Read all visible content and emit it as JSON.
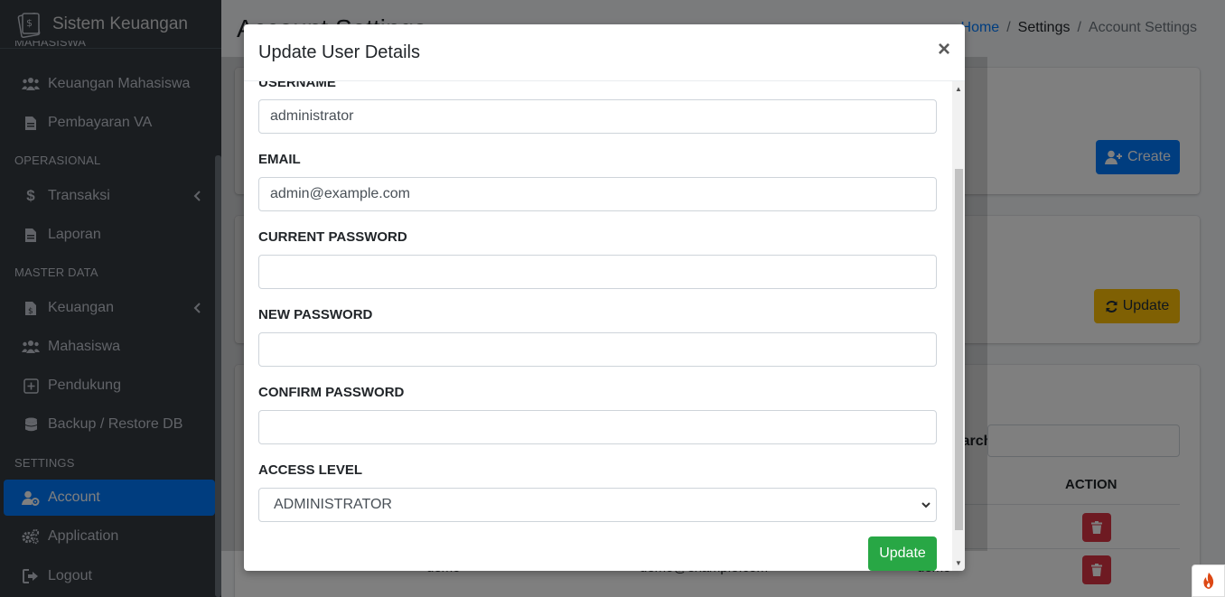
{
  "sidebar": {
    "brand": "Sistem Keuangan",
    "cut_header": "MAHASISWA",
    "sections": [
      {
        "header": "OPERASIONAL"
      },
      {
        "header": "MASTER DATA"
      },
      {
        "header": "SETTINGS"
      }
    ],
    "items": [
      {
        "label": "Keuangan Mahasiswa",
        "icon": "users-icon"
      },
      {
        "label": "Pembayaran VA",
        "icon": "file-invoice-icon"
      },
      {
        "label": "Transaksi",
        "icon": "dollar-icon"
      },
      {
        "label": "Laporan",
        "icon": "file-icon"
      },
      {
        "label": "Keuangan",
        "icon": "file-invoice-dollar-icon"
      },
      {
        "label": "Mahasiswa",
        "icon": "users-icon"
      },
      {
        "label": "Pendukung",
        "icon": "plus-square-icon"
      },
      {
        "label": "Backup / Restore DB",
        "icon": "database-icon"
      },
      {
        "label": "Account",
        "icon": "user-cog-icon"
      },
      {
        "label": "Application",
        "icon": "cogs-icon"
      },
      {
        "label": "Logout",
        "icon": "sign-out-icon"
      }
    ]
  },
  "header": {
    "title": "Account Settings",
    "breadcrumb": [
      "Home",
      "Settings",
      "Account Settings"
    ]
  },
  "background": {
    "create_label": "Create",
    "update_label": "Update",
    "search_label": "Search:",
    "action_header": "ACTION",
    "row_username": "demo",
    "row_email": "demo@example.com",
    "row_level": "demo"
  },
  "modal": {
    "title": "Update User Details",
    "close": "×",
    "fields": {
      "username_label": "USERNAME",
      "username_value": "administrator",
      "email_label": "EMAIL",
      "email_value": "admin@example.com",
      "current_password_label": "CURRENT PASSWORD",
      "new_password_label": "NEW PASSWORD",
      "confirm_password_label": "CONFIRM PASSWORD",
      "access_level_label": "ACCESS LEVEL",
      "access_level_value": "ADMINISTRATOR"
    },
    "submit_label": "Update"
  },
  "colors": {
    "sidebar_bg": "#343a40",
    "active": "#007bff",
    "success": "#28a745",
    "warning": "#ffc107",
    "danger": "#dc3545"
  }
}
